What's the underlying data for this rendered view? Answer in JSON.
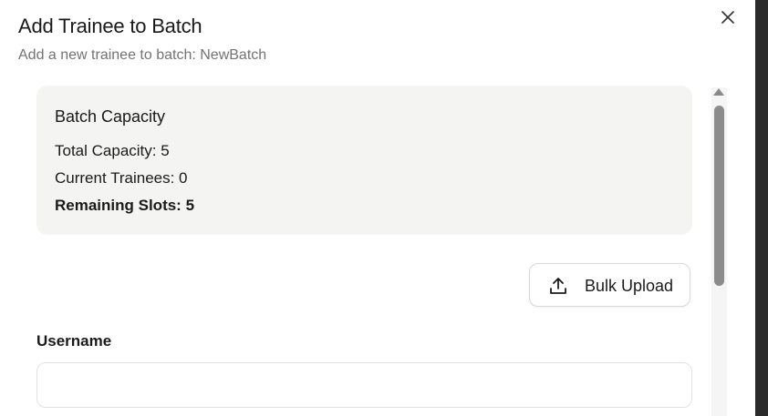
{
  "dialog": {
    "title": "Add Trainee to Batch",
    "subtitle": "Add a new trainee to batch: NewBatch",
    "close_icon": "close-icon"
  },
  "capacity": {
    "title": "Batch Capacity",
    "total": "Total Capacity: 5",
    "current": "Current Trainees: 0",
    "remaining": "Remaining Slots: 5"
  },
  "bulk_upload": {
    "label": "Bulk Upload",
    "icon": "upload-icon"
  },
  "form": {
    "username_label": "Username",
    "username_value": "",
    "username_placeholder": ""
  },
  "colors": {
    "card_background": "#f4f4f3",
    "subtitle_text": "#737373",
    "scrollbar_thumb": "#8c8c8c"
  }
}
